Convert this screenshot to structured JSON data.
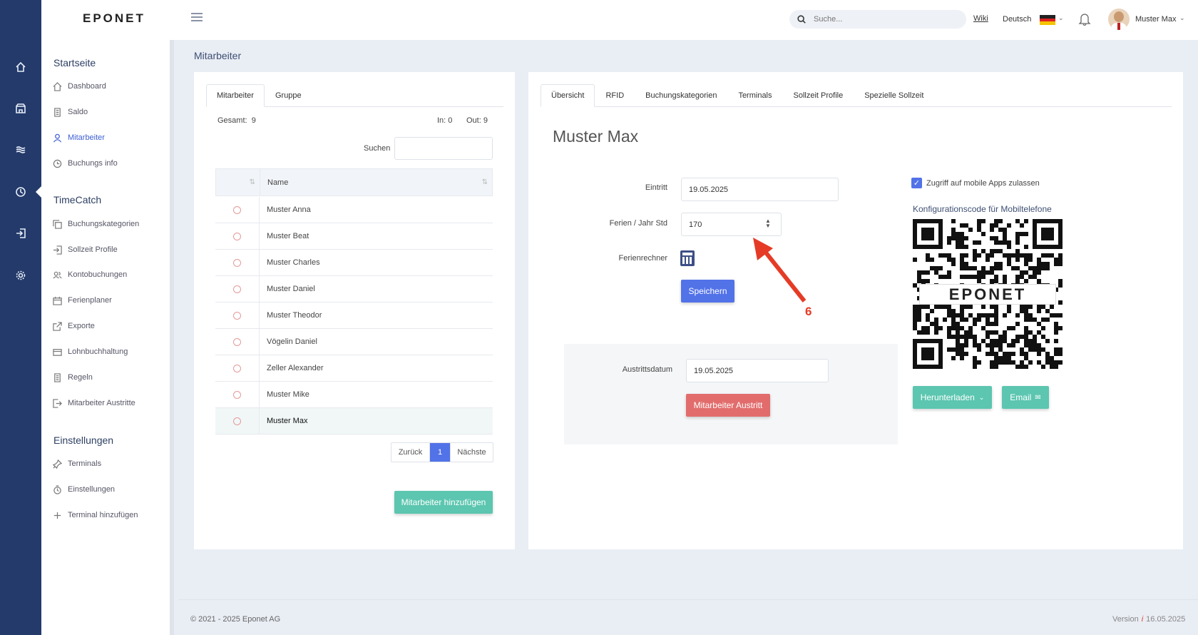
{
  "brand": {
    "logo_text": "EPONET"
  },
  "topbar": {
    "search_placeholder": "Suche...",
    "wiki_label": "Wiki",
    "language": "Deutsch",
    "user_name": "Muster Max"
  },
  "sidebar": {
    "sections": [
      {
        "title": "Startseite",
        "items": [
          {
            "label": "Dashboard",
            "icon": "home-icon"
          },
          {
            "label": "Saldo",
            "icon": "document-icon"
          },
          {
            "label": "Mitarbeiter",
            "icon": "user-icon",
            "active": true
          },
          {
            "label": "Buchungs info",
            "icon": "history-icon"
          }
        ]
      },
      {
        "title": "TimeCatch",
        "items": [
          {
            "label": "Buchungskategorien",
            "icon": "copy-icon"
          },
          {
            "label": "Sollzeit Profile",
            "icon": "login-icon"
          },
          {
            "label": "Kontobuchungen",
            "icon": "users-icon"
          },
          {
            "label": "Ferienplaner",
            "icon": "calendar-icon"
          },
          {
            "label": "Exporte",
            "icon": "export-icon"
          },
          {
            "label": "Lohnbuchhaltung",
            "icon": "wallet-icon"
          },
          {
            "label": "Regeln",
            "icon": "document-icon"
          },
          {
            "label": "Mitarbeiter Austritte",
            "icon": "logout-icon"
          }
        ]
      },
      {
        "title": "Einstellungen",
        "items": [
          {
            "label": "Terminals",
            "icon": "pin-icon"
          },
          {
            "label": "Einstellungen",
            "icon": "timer-icon"
          },
          {
            "label": "Terminal hinzufügen",
            "icon": "plus-icon"
          }
        ]
      }
    ]
  },
  "page": {
    "title": "Mitarbeiter"
  },
  "left_panel": {
    "tabs": [
      "Mitarbeiter",
      "Gruppe"
    ],
    "total_label": "Gesamt:",
    "total_value": "9",
    "in_label": "In:",
    "in_value": "0",
    "out_label": "Out:",
    "out_value": "9",
    "search_label": "Suchen",
    "column_name": "Name",
    "employees": [
      "Muster Anna",
      "Muster Beat",
      "Muster Charles",
      "Muster Daniel",
      "Muster Theodor",
      "Vögelin Daniel",
      "Zeller Alexander",
      "Muster Mike",
      "Muster Max"
    ],
    "pagination": {
      "prev": "Zurück",
      "current": "1",
      "next": "Nächste"
    },
    "add_button": "Mitarbeiter hinzufügen"
  },
  "right_panel": {
    "tabs": [
      "Übersicht",
      "RFID",
      "Buchungskategorien",
      "Terminals",
      "Sollzeit Profile",
      "Spezielle Sollzeit"
    ],
    "employee_name": "Muster Max",
    "eintritt_label": "Eintritt",
    "eintritt_value": "19.05.2025",
    "ferien_label": "Ferien / Jahr Std",
    "ferien_value": "170",
    "ferienrechner_label": "Ferienrechner",
    "save_button": "Speichern",
    "annotation_number": "6",
    "austritt_label": "Austrittsdatum",
    "austritt_value": "19.05.2025",
    "austritt_button": "Mitarbeiter Austritt",
    "mobile_access_label": "Zugriff auf mobile Apps zulassen",
    "mobile_access_checked": true,
    "qr_title": "Konfigurationscode für Mobiltelefone",
    "qr_logo_text": "EPONET",
    "download_button": "Herunterladen",
    "email_button": "Email"
  },
  "footer": {
    "copyright": "© 2021 - 2025 Eponet AG",
    "version_label": "Version",
    "version_date": "16.05.2025"
  },
  "colors": {
    "rail": "#233a6a",
    "primary": "#5272e8",
    "teal": "#5cc6b0",
    "danger": "#e26c6c",
    "annotation": "#e53b26"
  }
}
